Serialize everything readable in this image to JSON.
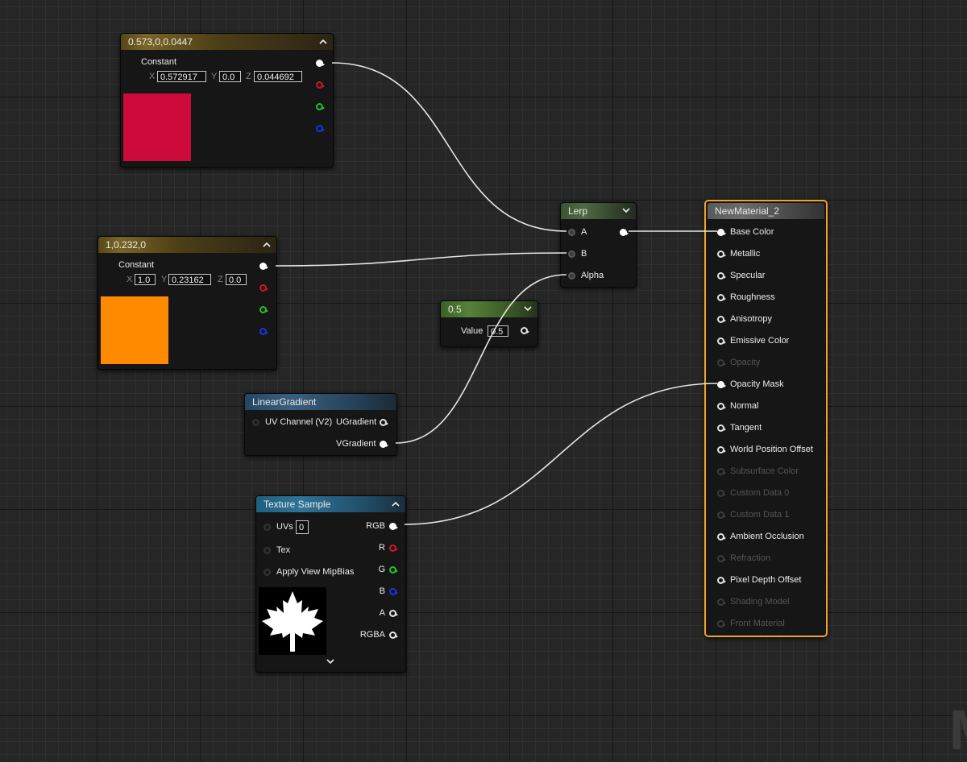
{
  "watermark": "M",
  "colors": {
    "const1_swatch": "#CC0A3C",
    "const2_swatch": "#FF8A00",
    "selection_outline": "#F3A229",
    "wire": "#E6E6E6"
  },
  "nodes": {
    "constant1": {
      "title": "0.573,0,0.0447",
      "label": "Constant",
      "x_label": "X",
      "x_value": "0.572917",
      "y_label": "Y",
      "y_value": "0.0",
      "z_label": "Z",
      "z_value": "0.044692"
    },
    "constant2": {
      "title": "1,0.232,0",
      "label": "Constant",
      "x_label": "X",
      "x_value": "1.0",
      "y_label": "Y",
      "y_value": "0.23162",
      "z_label": "Z",
      "z_value": "0.0"
    },
    "lerp": {
      "title": "Lerp",
      "pin_a": "A",
      "pin_b": "B",
      "pin_alpha": "Alpha"
    },
    "scalar": {
      "title": "0.5",
      "value_label": "Value",
      "value": "0.5"
    },
    "linear_gradient": {
      "title": "LinearGradient",
      "input": "UV Channel (V2)",
      "out_u": "UGradient",
      "out_v": "VGradient"
    },
    "texture_sample": {
      "title": "Texture Sample",
      "uvs_label": "UVs",
      "uvs_value": "0",
      "tex_label": "Tex",
      "mip_label": "Apply View MipBias",
      "outputs": [
        "RGB",
        "R",
        "G",
        "B",
        "A",
        "RGBA"
      ]
    },
    "material": {
      "title": "NewMaterial_2",
      "inputs": [
        {
          "label": "Base Color",
          "enabled": true,
          "connected": true
        },
        {
          "label": "Metallic",
          "enabled": true,
          "connected": false
        },
        {
          "label": "Specular",
          "enabled": true,
          "connected": false
        },
        {
          "label": "Roughness",
          "enabled": true,
          "connected": false
        },
        {
          "label": "Anisotropy",
          "enabled": true,
          "connected": false
        },
        {
          "label": "Emissive Color",
          "enabled": true,
          "connected": false
        },
        {
          "label": "Opacity",
          "enabled": false,
          "connected": false
        },
        {
          "label": "Opacity Mask",
          "enabled": true,
          "connected": true
        },
        {
          "label": "Normal",
          "enabled": true,
          "connected": false
        },
        {
          "label": "Tangent",
          "enabled": true,
          "connected": false
        },
        {
          "label": "World Position Offset",
          "enabled": true,
          "connected": false
        },
        {
          "label": "Subsurface Color",
          "enabled": false,
          "connected": false
        },
        {
          "label": "Custom Data 0",
          "enabled": false,
          "connected": false
        },
        {
          "label": "Custom Data 1",
          "enabled": false,
          "connected": false
        },
        {
          "label": "Ambient Occlusion",
          "enabled": true,
          "connected": false
        },
        {
          "label": "Refraction",
          "enabled": false,
          "connected": false
        },
        {
          "label": "Pixel Depth Offset",
          "enabled": true,
          "connected": false
        },
        {
          "label": "Shading Model",
          "enabled": false,
          "connected": false
        },
        {
          "label": "Front Material",
          "enabled": false,
          "connected": false
        }
      ]
    }
  }
}
